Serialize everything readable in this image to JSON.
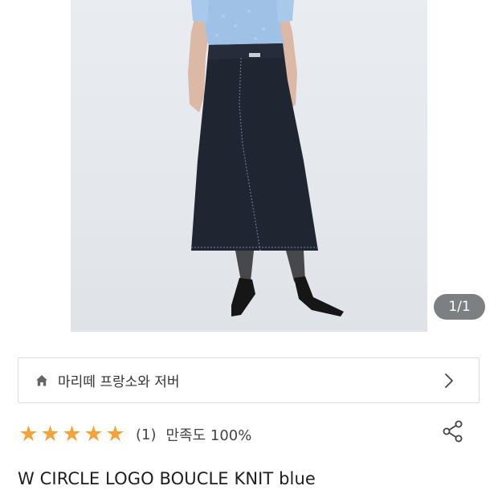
{
  "gallery": {
    "image_alt": "model wearing navy denim skirt and light blue knit top",
    "counter": "1/1"
  },
  "brand": {
    "icon": "home-icon",
    "name": "마리떼 프랑소와 저버",
    "chevron_icon": "chevron-right-icon"
  },
  "rating": {
    "stars": 5,
    "star_color": "#f2a43a",
    "review_count": "(1)",
    "satisfaction": "만족도 100%"
  },
  "share": {
    "icon": "share-icon"
  },
  "product": {
    "title": "W CIRCLE LOGO BOUCLE KNIT blue"
  }
}
